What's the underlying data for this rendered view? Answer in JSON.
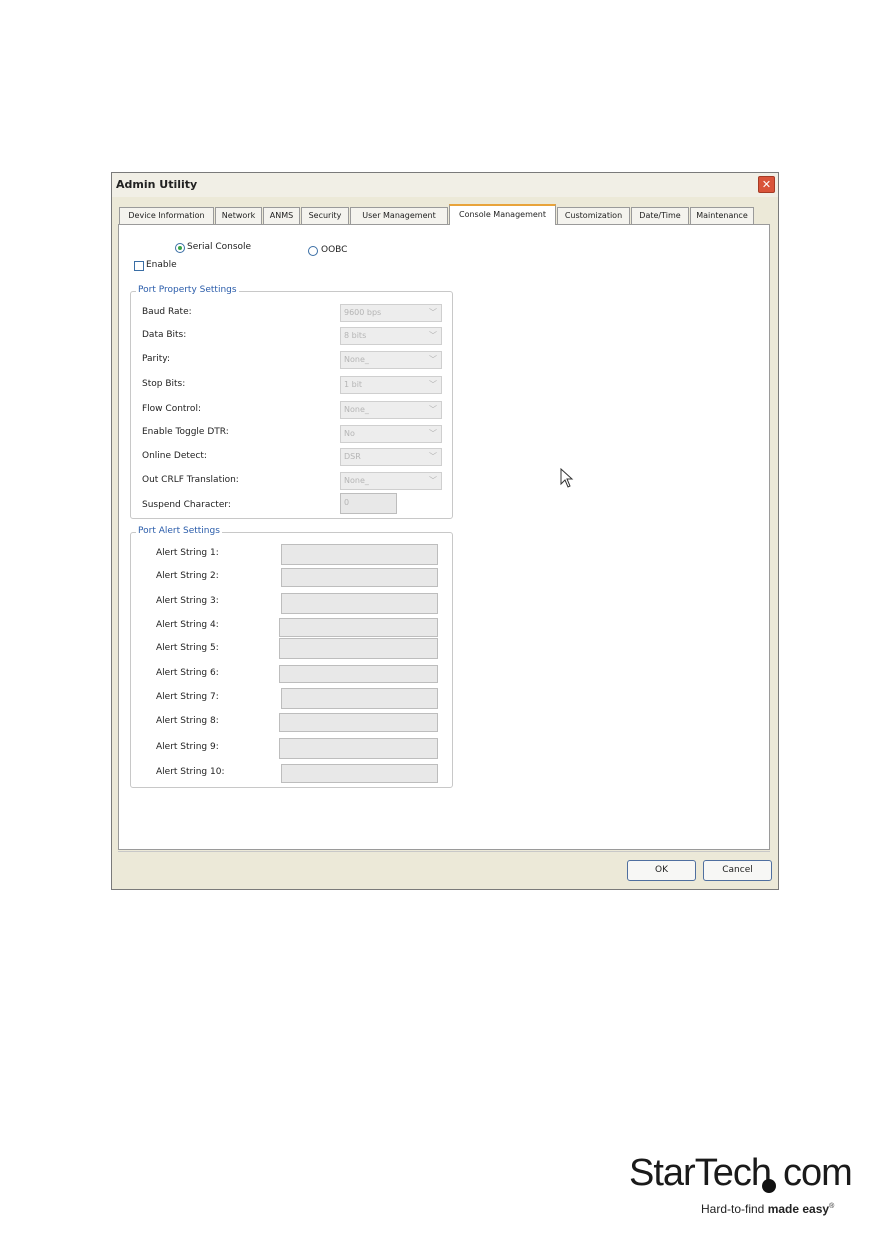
{
  "window": {
    "title": "Admin Utility",
    "close_glyph": "✕"
  },
  "tabs": [
    {
      "label": "Device Information"
    },
    {
      "label": "Network"
    },
    {
      "label": "ANMS"
    },
    {
      "label": "Security"
    },
    {
      "label": "User Management"
    },
    {
      "label": "Console Management",
      "active": true
    },
    {
      "label": "Customization"
    },
    {
      "label": "Date/Time"
    },
    {
      "label": "Maintenance"
    }
  ],
  "mode": {
    "serial_console": "Serial Console",
    "oobc": "OOBC",
    "selected": "Serial Console"
  },
  "enable": {
    "label": "Enable",
    "checked": false
  },
  "port_property": {
    "legend": "Port Property Settings",
    "fields": [
      {
        "label": "Baud Rate:",
        "value": "9600 bps"
      },
      {
        "label": "Data Bits:",
        "value": "8 bits"
      },
      {
        "label": "Parity:",
        "value": "None_"
      },
      {
        "label": "Stop Bits:",
        "value": "1 bit"
      },
      {
        "label": "Flow Control:",
        "value": "None_"
      },
      {
        "label": "Enable Toggle DTR:",
        "value": "No"
      },
      {
        "label": "Online Detect:",
        "value": "DSR"
      },
      {
        "label": "Out CRLF Translation:",
        "value": "None_"
      },
      {
        "label": "Suspend Character:",
        "value": "0"
      }
    ]
  },
  "port_alert": {
    "legend": "Port Alert Settings",
    "fields": [
      {
        "label": "Alert String 1:"
      },
      {
        "label": "Alert String 2:"
      },
      {
        "label": "Alert String 3:"
      },
      {
        "label": "Alert String 4:"
      },
      {
        "label": "Alert String 5:"
      },
      {
        "label": "Alert String 6:"
      },
      {
        "label": "Alert String 7:"
      },
      {
        "label": "Alert String 8:"
      },
      {
        "label": "Alert String 9:"
      },
      {
        "label": "Alert String 10:"
      }
    ]
  },
  "buttons": {
    "ok": "OK",
    "cancel": "Cancel"
  },
  "brand": {
    "name": "StarTech",
    "suffix": "com",
    "tagline_plain": "Hard-to-find ",
    "tagline_bold": "made easy",
    "reg": "®"
  },
  "icons": {
    "dropdown": "chevron-down-icon",
    "cursor": "mouse-pointer-icon"
  }
}
